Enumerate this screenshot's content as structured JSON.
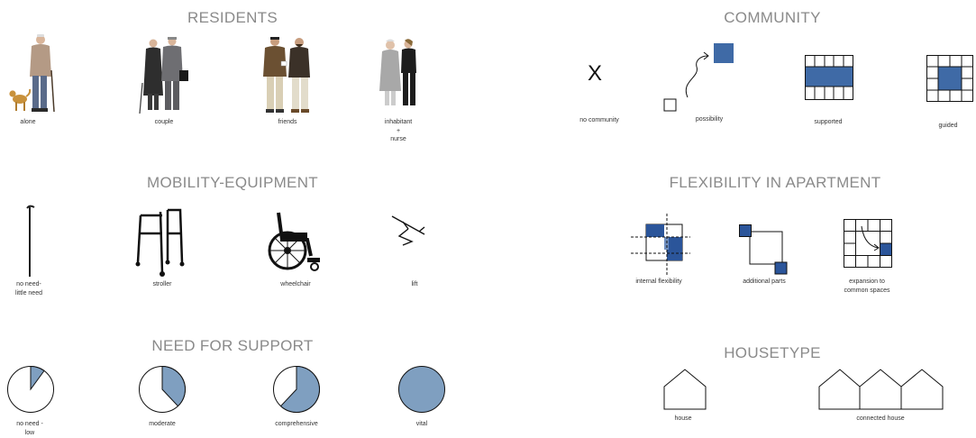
{
  "residents": {
    "title": "RESIDENTS",
    "items": [
      {
        "label": "alone"
      },
      {
        "label": "couple"
      },
      {
        "label": "friends"
      },
      {
        "label_lines": [
          "inhabitant",
          "+",
          "nurse"
        ]
      }
    ]
  },
  "community": {
    "title": "COMMUNITY",
    "items": [
      {
        "label": "no community",
        "symbol": "X"
      },
      {
        "label": "possibility"
      },
      {
        "label": "supported"
      },
      {
        "label": "guided"
      }
    ]
  },
  "mobility": {
    "title": "MOBILITY-EQUIPMENT",
    "items": [
      {
        "label_lines": [
          "no need-",
          "little need"
        ],
        "icon": "cane-icon"
      },
      {
        "label": "stroller",
        "icon": "walker-icon"
      },
      {
        "label": "wheelchair",
        "icon": "wheelchair-icon"
      },
      {
        "label": "lift",
        "icon": "lift-icon"
      }
    ]
  },
  "flexibility": {
    "title": "FLEXIBILITY IN APARTMENT",
    "items": [
      {
        "label": "internal flexibility"
      },
      {
        "label": "additional parts"
      },
      {
        "label_lines": [
          "expansion to",
          "common spaces"
        ]
      }
    ]
  },
  "support": {
    "title": "NEED FOR SUPPORT",
    "items": [
      {
        "label_lines": [
          "no need -",
          "low"
        ],
        "level": 0.1
      },
      {
        "label": "moderate",
        "level": 0.38
      },
      {
        "label": "comprehensive",
        "level": 0.62
      },
      {
        "label": "vital",
        "level": 1.0
      }
    ]
  },
  "housetype": {
    "title": "HOUSETYPE",
    "items": [
      {
        "label": "house"
      },
      {
        "label": "connected house"
      }
    ]
  },
  "colors": {
    "accent": "#4a6fa5",
    "pie": "#7f9fc0",
    "heading": "#8a8a8a"
  }
}
